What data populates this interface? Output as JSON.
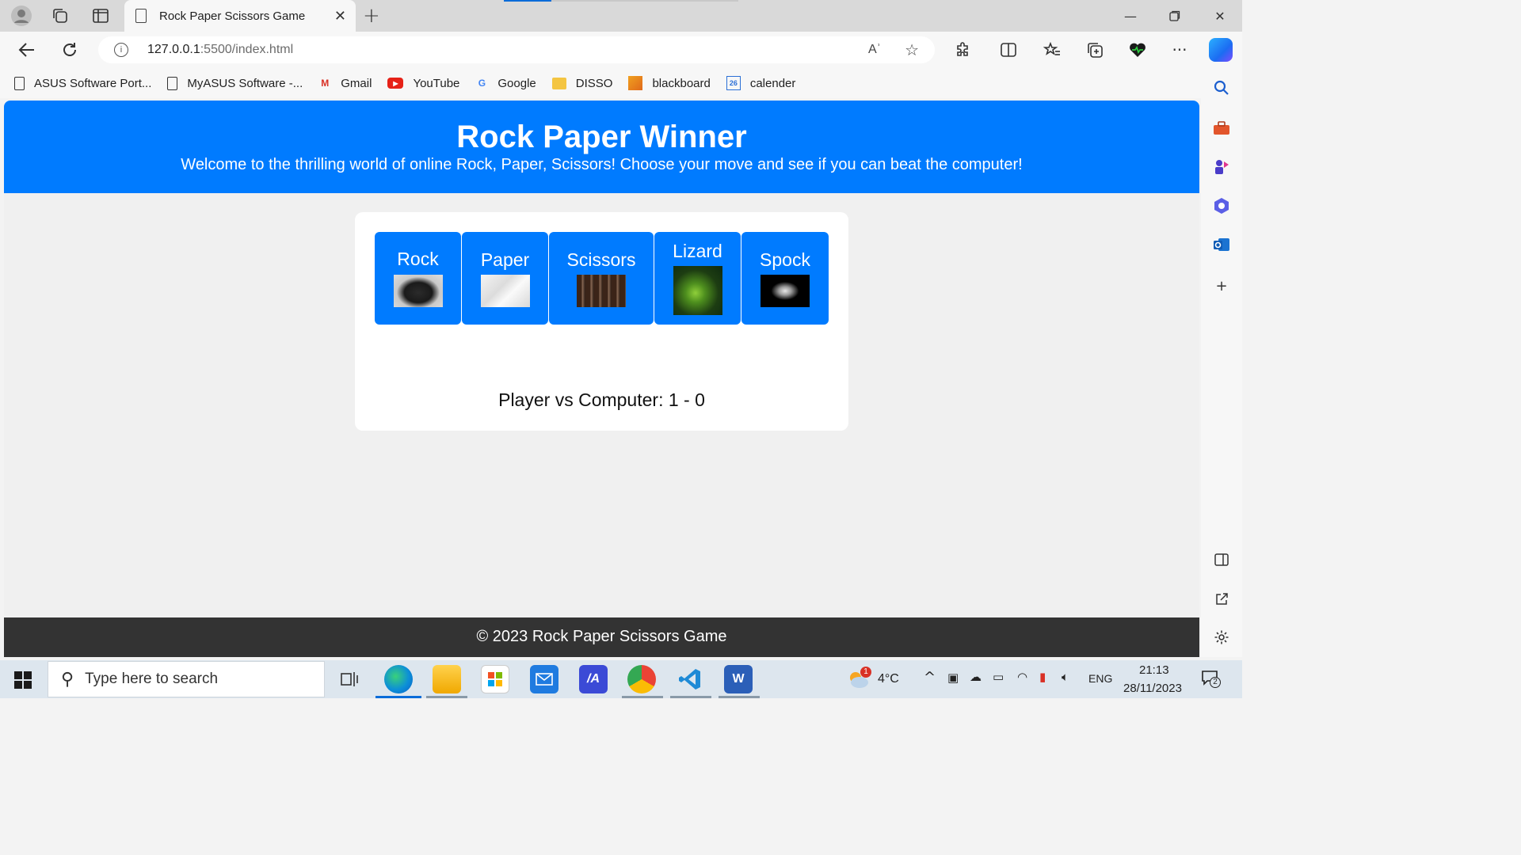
{
  "browser": {
    "tab_title": "Rock Paper Scissors Game",
    "url_host": "127.0.0.1",
    "url_path": ":5500/index.html",
    "read_aloud": "Aʾ",
    "bookmarks": [
      {
        "label": "ASUS Software Port...",
        "icon": "page-icon"
      },
      {
        "label": "MyASUS Software -...",
        "icon": "page-icon"
      },
      {
        "label": "Gmail",
        "icon": "gmail-icon"
      },
      {
        "label": "YouTube",
        "icon": "youtube-icon"
      },
      {
        "label": "Google",
        "icon": "google-icon"
      },
      {
        "label": "DISSO",
        "icon": "folder-icon"
      },
      {
        "label": "blackboard",
        "icon": "blackboard-icon"
      },
      {
        "label": "calender",
        "icon": "calendar-icon"
      }
    ]
  },
  "page": {
    "title": "Rock Paper Winner",
    "subtitle": "Welcome to the thrilling world of online Rock, Paper, Scissors! Choose your move and see if you can beat the computer!",
    "choices": [
      {
        "label": "Rock"
      },
      {
        "label": "Paper"
      },
      {
        "label": "Scissors"
      },
      {
        "label": "Lizard"
      },
      {
        "label": "Spock"
      }
    ],
    "score": "Player vs Computer: 1 - 0",
    "footer": "© 2023 Rock Paper Scissors Game"
  },
  "taskbar": {
    "search_placeholder": "Type here to search",
    "weather_temp": "4°C",
    "weather_badge": "1",
    "language": "ENG",
    "time": "21:13",
    "date": "28/11/2023",
    "notifications": "2",
    "calendar_day": "26"
  },
  "colors": {
    "accent": "#007bff",
    "footer_bg": "#333333",
    "page_bg": "#f0f0f0"
  }
}
